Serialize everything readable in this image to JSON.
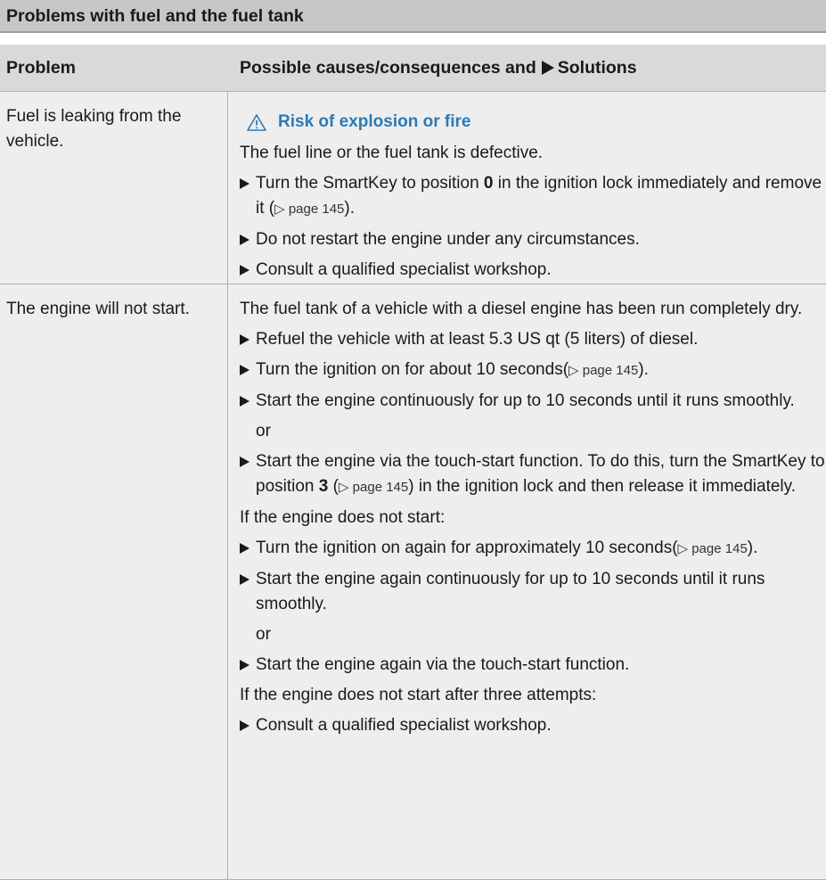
{
  "section_title": "Problems with fuel and the fuel tank",
  "header": {
    "col1": "Problem",
    "col2_prefix": "Possible causes/consequences and",
    "col2_suffix": "Solutions"
  },
  "row1": {
    "problem": "Fuel is leaking from the vehicle.",
    "warning": "Risk of explosion or fire",
    "cause": "The fuel line or the fuel tank is defective.",
    "step1_a": "Turn the SmartKey to position",
    "step1_bold": "0",
    "step1_b": "in the ignition lock immediately and remove it (",
    "step1_page": "▷ page 145",
    "step1_c": ").",
    "step2": "Do not restart the engine under any circumstances.",
    "step3": "Consult a qualified specialist workshop."
  },
  "row2": {
    "problem": "The engine will not start.",
    "cause": "The fuel tank of a vehicle with a diesel engine has been run completely dry.",
    "step1": "Refuel the vehicle with at least 5.3 US qt (5 liters) of diesel.",
    "step2_a": "Turn the ignition on for about 10 seconds(",
    "step2_page": "▷ page 145",
    "step2_b": ").",
    "step3": "Start the engine continuously for up to 10 seconds until it runs smoothly.",
    "or1": "or",
    "step4_a": "Start the engine via the touch-start function. To do this, turn the SmartKey to position",
    "step4_bold": "3",
    "step4_b": "(",
    "step4_page": "▷ page 145",
    "step4_c": ") in the ignition lock and then release it immediately.",
    "if_not_start": "If the engine does not start:",
    "step5_a": "Turn the ignition on again for approximately 10 seconds(",
    "step5_page": "▷ page 145",
    "step5_b": ").",
    "step6": "Start the engine again continuously for up to 10 seconds until it runs smoothly.",
    "or2": "or",
    "step7": "Start the engine again via the touch-start function.",
    "if_three": "If the engine does not start after three attempts:",
    "step8": "Consult a qualified specialist workshop."
  },
  "colors": {
    "warning_blue": "#2a7bb8",
    "row_bg": "#eeeeee",
    "header_bg": "#d9d9d9",
    "title_bg": "#c7c7c7"
  },
  "icons": {
    "warning": "warning-triangle-icon",
    "step": "step-arrow-icon"
  }
}
